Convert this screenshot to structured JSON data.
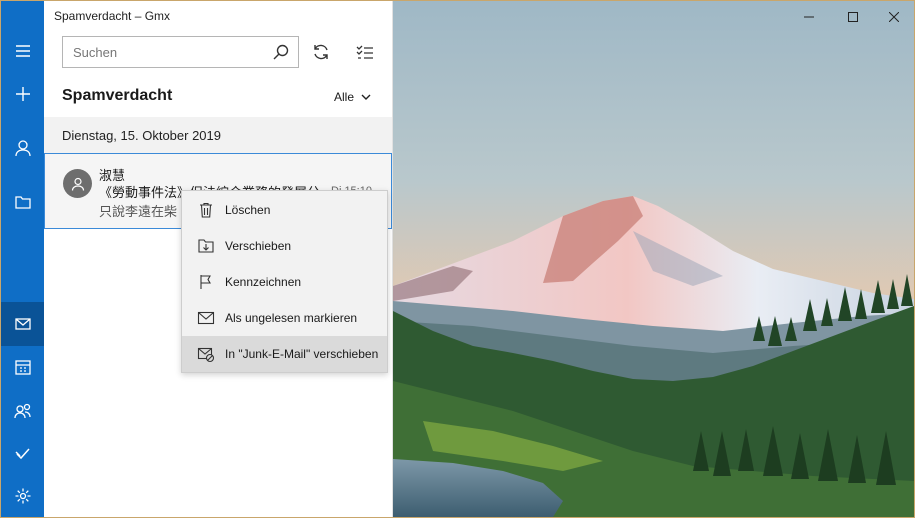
{
  "window": {
    "title": "Spamverdacht – Gmx"
  },
  "search": {
    "placeholder": "Suchen"
  },
  "folder": {
    "title": "Spamverdacht",
    "filter_label": "Alle"
  },
  "date_group": {
    "label": "Dienstag, 15. Oktober 2019"
  },
  "message": {
    "sender": "淑慧",
    "subject": "《勞動事件法》促法綜合業務的發展分",
    "preview": "只說李遠在柴",
    "time": "Di 15:10"
  },
  "context_menu": {
    "items": [
      {
        "label": "Löschen",
        "icon": "trash-icon"
      },
      {
        "label": "Verschieben",
        "icon": "move-icon"
      },
      {
        "label": "Kennzeichnen",
        "icon": "flag-icon"
      },
      {
        "label": "Als ungelesen markieren",
        "icon": "envelope-icon"
      },
      {
        "label": "In \"Junk-E-Mail\" verschieben",
        "icon": "junk-icon"
      }
    ]
  },
  "rail": {
    "items": [
      "menu-icon",
      "compose-icon",
      "accounts-icon",
      "folders-icon",
      "mail-icon",
      "calendar-icon",
      "people-icon",
      "todo-icon",
      "settings-icon"
    ]
  },
  "colors": {
    "accent": "#0f6ec6",
    "rail_active": "#0a5397",
    "selection_border": "#3b8ad8"
  }
}
